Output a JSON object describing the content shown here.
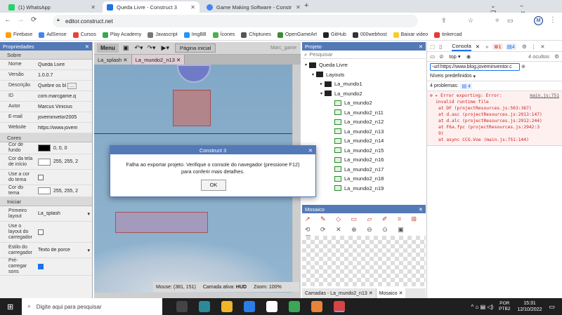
{
  "browser": {
    "tabs": [
      {
        "title": "(1) WhatsApp",
        "color": "#25d366"
      },
      {
        "title": "Queda Livre - Construct 3",
        "color": "#1a73e8"
      },
      {
        "title": "Game Making Software - Constr",
        "color": "#4285f4"
      }
    ],
    "url": "editor.construct.net",
    "bookmarks": [
      {
        "label": "Firebase",
        "color": "#ffa000"
      },
      {
        "label": "AdSense",
        "color": "#4285f4"
      },
      {
        "label": "Cursos",
        "color": "#ea4335"
      },
      {
        "label": "Play Academy",
        "color": "#34a853"
      },
      {
        "label": "Javascript",
        "color": "#777777"
      },
      {
        "label": "ImgBB",
        "color": "#2196f3"
      },
      {
        "label": "Ícones",
        "color": "#4caf50"
      },
      {
        "label": "Chiptunes",
        "color": "#555555"
      },
      {
        "label": "OpenGameArt",
        "color": "#3d8b37"
      },
      {
        "label": "GitHub",
        "color": "#222222"
      },
      {
        "label": "000webhost",
        "color": "#333333"
      },
      {
        "label": "Baixar video",
        "color": "#ffca28"
      },
      {
        "label": "tinkercad",
        "color": "#e53935"
      }
    ]
  },
  "properties": {
    "title": "Propriedades",
    "sections": [
      {
        "name": "Sobre",
        "rows": [
          {
            "key": "Nome",
            "value": "Queda Livre"
          },
          {
            "key": "Versão",
            "value": "1.0.0.7"
          },
          {
            "key": "Descrição",
            "value": "Quebre os bl"
          },
          {
            "key": "ID",
            "value": "com.marcgame.q"
          },
          {
            "key": "Autor",
            "value": "Marcus Vinicius"
          },
          {
            "key": "E-mail",
            "value": "joveminvetor2005"
          },
          {
            "key": "Website",
            "value": "https://www.jovem"
          }
        ]
      },
      {
        "name": "Cores",
        "rows": [
          {
            "key": "Cor de fundo",
            "value": "0, 0, 0"
          },
          {
            "key": "Cor da tela de início",
            "value": "255, 255, 2"
          },
          {
            "key": "Use a cor do tema",
            "value": ""
          },
          {
            "key": "Cor do tema",
            "value": "255, 255, 2"
          }
        ]
      },
      {
        "name": "Iniciar",
        "rows": [
          {
            "key": "Primeiro layout",
            "value": "La_splash"
          },
          {
            "key": "Use o layout do carregador",
            "value": ""
          },
          {
            "key": "Estilo do carregador",
            "value": "Texto de porce"
          },
          {
            "key": "Pré-carregar sons",
            "value": ""
          }
        ]
      }
    ]
  },
  "editor": {
    "menu": "Menu",
    "page_label": "Página inicial",
    "user": "Marc_game",
    "tabs": [
      "La_splash",
      "La_mundo2_n13"
    ],
    "status": {
      "mouse": "Mouse: (381, 151)",
      "layer_prefix": "Camada ativa:",
      "layer": "HUD",
      "zoom": "Zoom: 100%"
    }
  },
  "project": {
    "title": "Projeto",
    "search_placeholder": "Pesquisar",
    "root": "Queda Livre",
    "layouts": "Layouts",
    "folders": [
      "La_mundo1",
      "La_mundo2"
    ],
    "items": [
      "La_mundo2",
      "La_mundo2_n11",
      "La_mundo2_n12",
      "La_mundo2_n13",
      "La_mundo2_n14",
      "La_mundo2_n15",
      "La_mundo2_n16",
      "La_mundo2_n17",
      "La_mundo2_n18",
      "La_mundo2_n19"
    ]
  },
  "mosaic": {
    "title": "Mosaico",
    "bottom_tabs": [
      "Camadas - La_mundo2_n13",
      "Mosaico"
    ]
  },
  "devtools": {
    "tab": "Consola",
    "errors_count": "1",
    "messages_count": "4",
    "context": "top",
    "filter": "-url:https://www.blog.joveminventor.c",
    "hidden": "4 ocultos",
    "levels": "Níveis predefinidos",
    "issues": "4 problemas:",
    "issues_count": "4",
    "log": [
      {
        "text": "Error exporting:  Error:",
        "link": "main.js:751"
      },
      {
        "text": "invalid runtime file",
        "link": ""
      },
      {
        "text": "at DF (projectResources.js:503:367)",
        "link": ""
      },
      {
        "text": "at d.asc (projectResources.js:2913:147)",
        "link": ""
      },
      {
        "text": "at d.alc (projectResources.js:2912:244)",
        "link": ""
      },
      {
        "text": "at F6a.fpc (projectResources.js:2942:3",
        "link": ""
      },
      {
        "text": "9)",
        "link": ""
      },
      {
        "text": "at async CCG.Voe (main.js:751:144)",
        "link": ""
      }
    ]
  },
  "dialog": {
    "title": "Construct 3",
    "message_line1": "Falha ao exportar projeto. Verifique o console do navegador (pressione F12)",
    "message_line2": "para conferir mais detalhes.",
    "ok": "OK"
  },
  "taskbar": {
    "search_placeholder": "Digite aqui para pesquisar",
    "lang": "POR",
    "kbd": "PTB2",
    "time": "15:31",
    "date": "12/10/2022"
  }
}
